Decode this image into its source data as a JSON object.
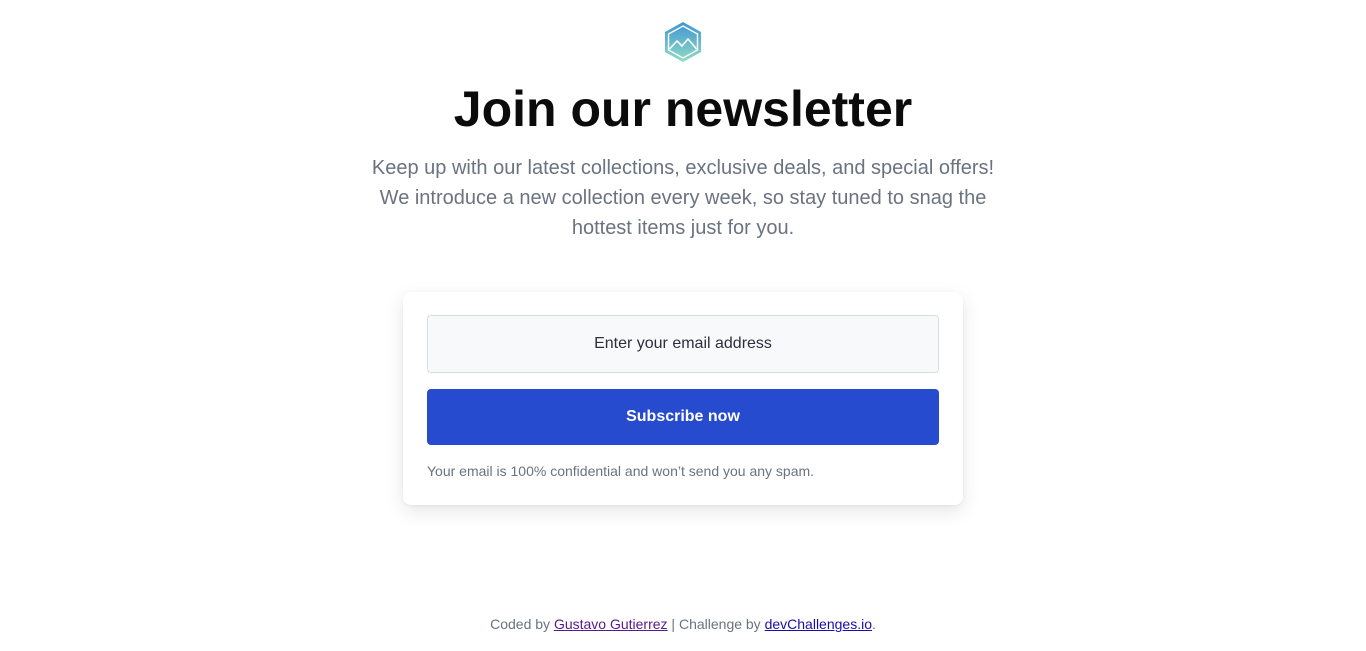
{
  "header": {
    "logo_icon": "hexagon-mountain-logo-icon",
    "title": "Join our newsletter",
    "subtitle": "Keep up with our latest collections, exclusive deals, and special offers! We introduce a new collection every week, so stay tuned to snag the hottest items just for you."
  },
  "form": {
    "email_placeholder": "Enter your email address",
    "email_value": "",
    "subscribe_label": "Subscribe now",
    "note": "Your email is 100% confidential and won’t send you any spam."
  },
  "footer": {
    "coded_by_text": "Coded by ",
    "author_link": "Gustavo Gutierrez",
    "separator_text": " | Challenge by ",
    "challenge_link": "devChallenges.io",
    "end_text": "."
  },
  "colors": {
    "accent": "#274bcf",
    "muted_text": "#6b7280",
    "logo_gradient_top": "#4aa3d9",
    "logo_gradient_bottom": "#8fd9c2"
  }
}
